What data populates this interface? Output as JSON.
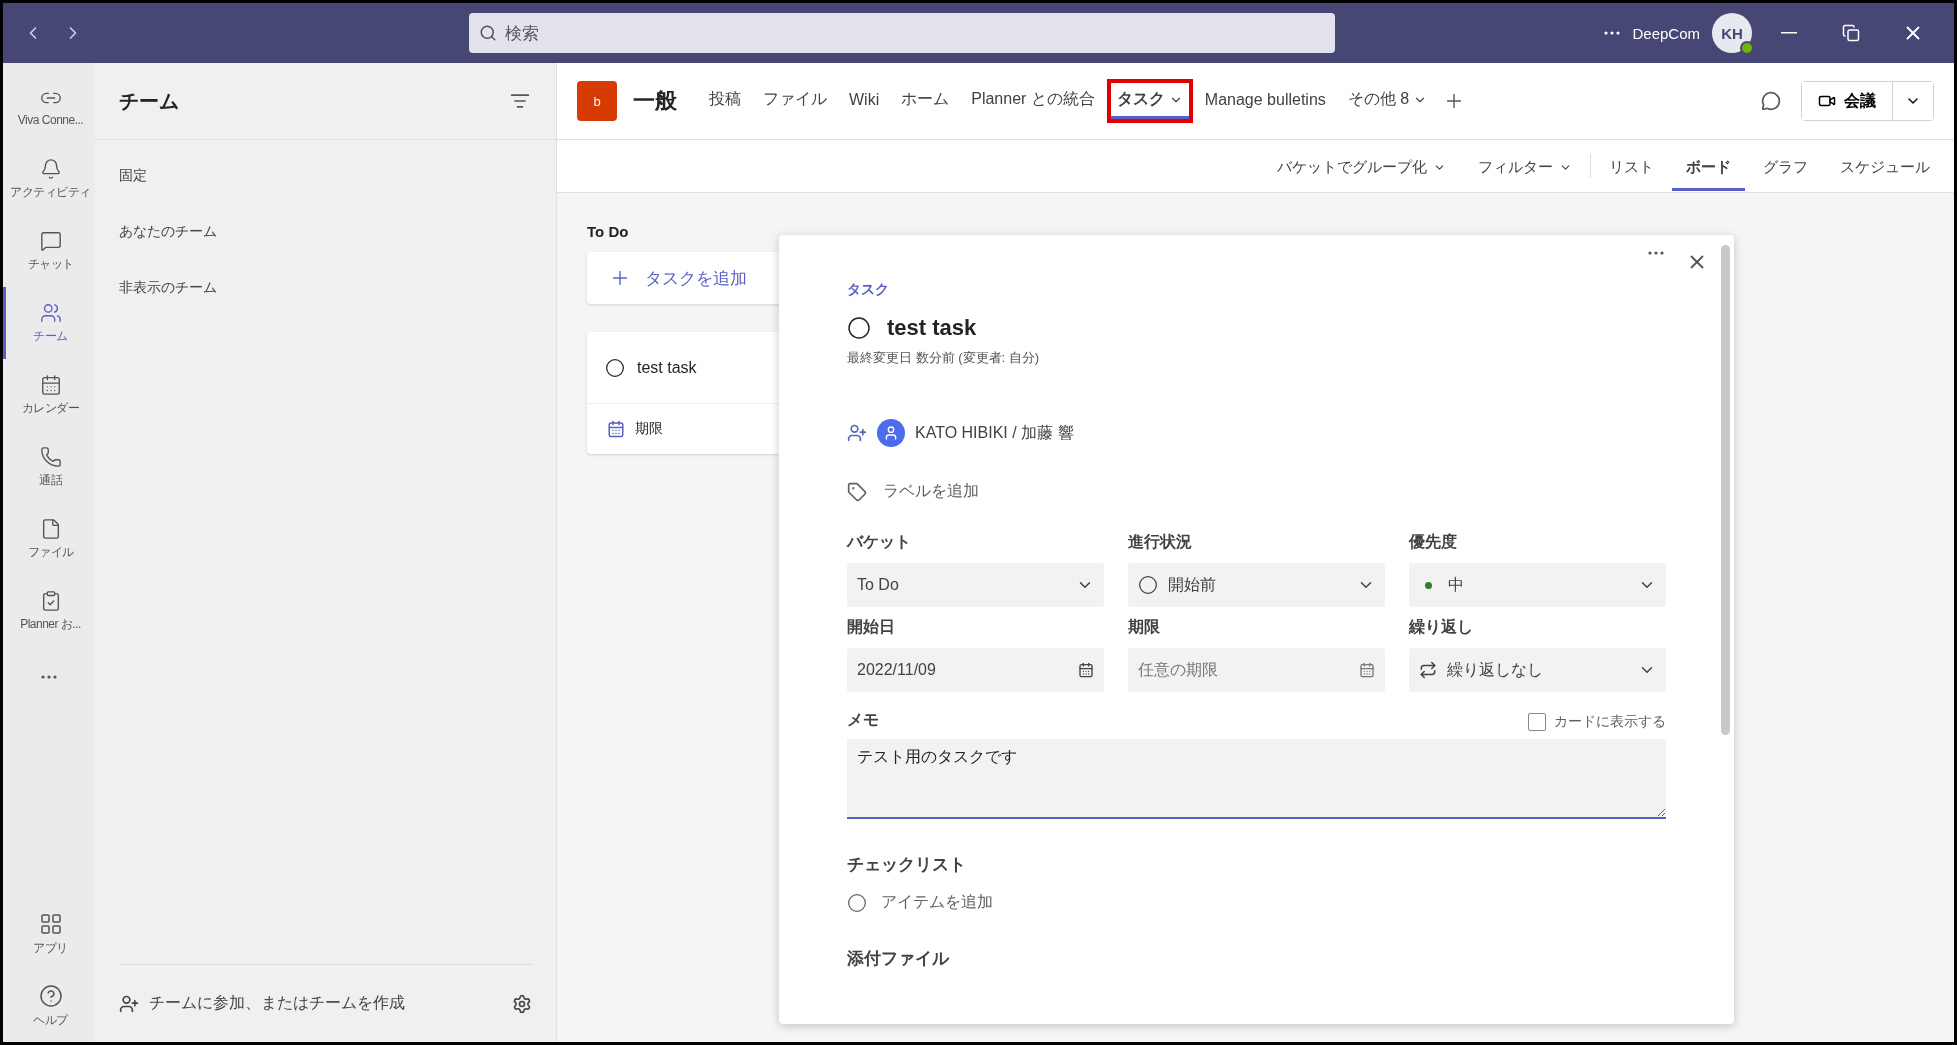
{
  "title_bar": {
    "search_placeholder": "検索",
    "org": "DeepCom",
    "avatar": "KH"
  },
  "rail": [
    {
      "label": "Viva Conne...",
      "selected": false
    },
    {
      "label": "アクティビティ",
      "selected": false
    },
    {
      "label": "チャット",
      "selected": false
    },
    {
      "label": "チーム",
      "selected": true
    },
    {
      "label": "カレンダー",
      "selected": false
    },
    {
      "label": "通話",
      "selected": false
    },
    {
      "label": "ファイル",
      "selected": false
    },
    {
      "label": "Planner お...",
      "selected": false
    }
  ],
  "rail_bottom": [
    {
      "label": "アプリ"
    },
    {
      "label": "ヘルプ"
    }
  ],
  "sidebar": {
    "title": "チーム",
    "sections": [
      "固定",
      "あなたのチーム",
      "非表示のチーム"
    ],
    "footer": "チームに参加、またはチームを作成"
  },
  "channel": {
    "badge": "b",
    "name": "一般",
    "tabs": [
      {
        "label": "投稿",
        "selected": false,
        "dropdown": false,
        "highlighted": false
      },
      {
        "label": "ファイル",
        "selected": false,
        "dropdown": false,
        "highlighted": false
      },
      {
        "label": "Wiki",
        "selected": false,
        "dropdown": false,
        "highlighted": false
      },
      {
        "label": "ホーム",
        "selected": false,
        "dropdown": false,
        "highlighted": false
      },
      {
        "label": "Planner との統合",
        "selected": false,
        "dropdown": false,
        "highlighted": false
      },
      {
        "label": "タスク",
        "selected": true,
        "dropdown": true,
        "highlighted": true
      },
      {
        "label": "Manage bulletins",
        "selected": false,
        "dropdown": false,
        "highlighted": false
      },
      {
        "label": "その他 8",
        "selected": false,
        "dropdown": true,
        "highlighted": false
      }
    ],
    "meeting": "会議"
  },
  "view_bar": [
    {
      "label": "バケットでグループ化",
      "kind": "dropdown",
      "selected": false
    },
    {
      "label": "フィルター",
      "kind": "dropdown",
      "selected": false
    },
    {
      "label": "リスト",
      "kind": "view",
      "selected": false
    },
    {
      "label": "ボード",
      "kind": "view",
      "selected": true
    },
    {
      "label": "グラフ",
      "kind": "view",
      "selected": false
    },
    {
      "label": "スケジュール",
      "kind": "view",
      "selected": false
    }
  ],
  "board": {
    "bucket": "To Do",
    "add_task": "タスクを追加",
    "card": {
      "title": "test task",
      "completed": false,
      "due": "期限"
    }
  },
  "task_panel": {
    "heading": "タスク",
    "title": "test task",
    "completed": false,
    "modified": "最終変更日 数分前 (変更者: 自分)",
    "assignee": "KATO HIBIKI / 加藤 響",
    "add_label": "ラベルを追加",
    "fields": [
      {
        "label": "バケット",
        "kind": "dropdown",
        "value": "To Do"
      },
      {
        "label": "進行状況",
        "kind": "status",
        "value": "開始前"
      },
      {
        "label": "優先度",
        "kind": "priority",
        "value": "中"
      },
      {
        "label": "開始日",
        "kind": "date",
        "value": "2022/11/09"
      },
      {
        "label": "期限",
        "kind": "date",
        "placeholder": "任意の期限"
      },
      {
        "label": "繰り返し",
        "kind": "repeat",
        "value": "繰り返しなし"
      }
    ],
    "memo": {
      "label": "メモ",
      "show_on_card": {
        "label": "カードに表示する",
        "checked": false
      },
      "value": "テスト用のタスクです"
    },
    "checklist": {
      "label": "チェックリスト",
      "add_item": "アイテムを追加"
    },
    "attachments": {
      "label": "添付ファイル"
    }
  }
}
